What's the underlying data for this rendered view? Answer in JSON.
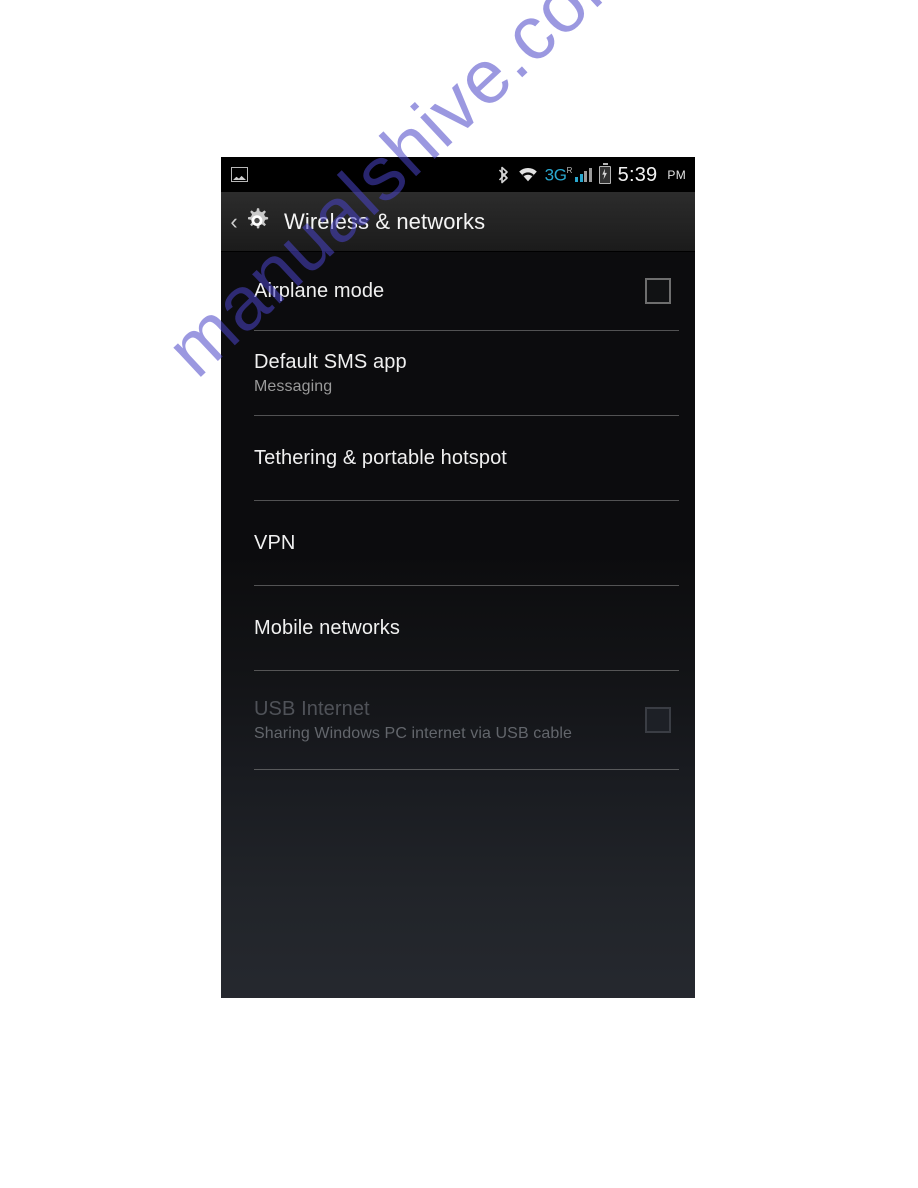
{
  "watermark": {
    "text": "manualshive.com"
  },
  "phone": {
    "status_bar": {
      "notification_icon": "picture-icon",
      "bluetooth_icon": "bluetooth-icon",
      "bluetooth_glyph": "ᛦ",
      "wifi_icon": "wifi-icon",
      "network_type": "3G",
      "roaming_indicator": "R",
      "signal_icon": "signal-bars-icon",
      "battery_icon": "battery-charging-icon",
      "time": "5:39",
      "ampm": "PM"
    },
    "action_bar": {
      "back_icon": "back-chevron-icon",
      "back_glyph": "‹",
      "app_icon": "settings-gear-icon",
      "title": "Wireless & networks"
    },
    "settings": [
      {
        "id": "airplane-mode",
        "title": "Airplane mode",
        "subtitle": "",
        "has_checkbox": true,
        "checked": false,
        "disabled": false
      },
      {
        "id": "default-sms-app",
        "title": "Default SMS app",
        "subtitle": "Messaging",
        "has_checkbox": false,
        "checked": false,
        "disabled": false
      },
      {
        "id": "tethering-portable-hotspot",
        "title": "Tethering & portable hotspot",
        "subtitle": "",
        "has_checkbox": false,
        "checked": false,
        "disabled": false
      },
      {
        "id": "vpn",
        "title": "VPN",
        "subtitle": "",
        "has_checkbox": false,
        "checked": false,
        "disabled": false
      },
      {
        "id": "mobile-networks",
        "title": "Mobile networks",
        "subtitle": "",
        "has_checkbox": false,
        "checked": false,
        "disabled": false
      },
      {
        "id": "usb-internet",
        "title": "USB Internet",
        "subtitle": "Sharing Windows PC internet via USB cable",
        "has_checkbox": true,
        "checked": false,
        "disabled": true
      }
    ]
  },
  "colors": {
    "accent_3g": "#2aa8cf",
    "status_bar_bg": "#000000",
    "action_bar_bg": "#232323",
    "list_bg_top": "#0c0c0e",
    "list_bg_bottom": "#2a2d34",
    "title_text": "#f0f0f0",
    "subtitle_text": "#9a9a9a",
    "disabled_text": "#4f5258",
    "watermark": "#4a44c8"
  }
}
